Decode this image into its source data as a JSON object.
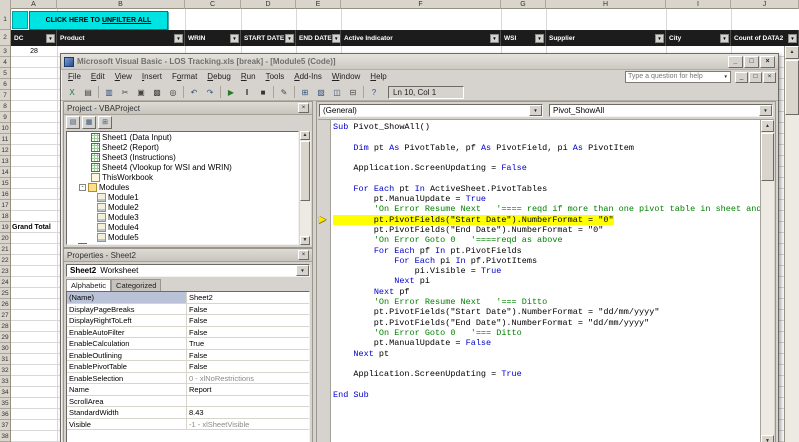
{
  "icons": {
    "dropdown": "▼",
    "scroll_up": "▲",
    "scroll_down": "▼",
    "close": "×",
    "minimize": "_",
    "restore": "□",
    "execution_arrow": "▶",
    "filter_arrow": "▼"
  },
  "excel": {
    "column_letters": [
      "A",
      "B",
      "C",
      "D",
      "E",
      "F",
      "G",
      "H",
      "I",
      "J"
    ],
    "filter_headers": [
      "DC",
      "Product",
      "WRIN",
      "START DATE",
      "END DATE",
      "Active Indicator",
      "WSI",
      "Supplier",
      "City",
      "Count of DATA2"
    ],
    "row_numbers": [
      "1",
      "2",
      "3",
      "4",
      "5",
      "6",
      "7",
      "8",
      "9",
      "10",
      "11",
      "12",
      "13",
      "14",
      "15",
      "16",
      "17",
      "18",
      "19",
      "20",
      "21",
      "22",
      "23",
      "24",
      "25",
      "26",
      "27",
      "28",
      "29",
      "30",
      "31",
      "32",
      "33",
      "34",
      "35",
      "36",
      "37",
      "38"
    ],
    "unfilter_button": {
      "prefix": "CLICK HERE TO ",
      "underline": "UNFILTER ALL"
    },
    "cells": {
      "a3": "28",
      "grand_total": "Grand Total"
    }
  },
  "vbe": {
    "title": "Microsoft Visual Basic - LOS Tracking.xls [break] - [Module5 (Code)]",
    "help_box": "Type a question for help",
    "position_indicator": "Ln 10, Col 1",
    "menus": [
      {
        "label": "File",
        "u": 0
      },
      {
        "label": "Edit",
        "u": 0
      },
      {
        "label": "View",
        "u": 0
      },
      {
        "label": "Insert",
        "u": 0
      },
      {
        "label": "Format",
        "u": 1
      },
      {
        "label": "Debug",
        "u": 0
      },
      {
        "label": "Run",
        "u": 0
      },
      {
        "label": "Tools",
        "u": 0
      },
      {
        "label": "Add-Ins",
        "u": 0
      },
      {
        "label": "Window",
        "u": 0
      },
      {
        "label": "Help",
        "u": 0
      }
    ],
    "toolbar": [
      {
        "name": "view-excel-icon",
        "glyph": "X",
        "color": "#1f7145"
      },
      {
        "name": "insert-userform-icon",
        "glyph": "▤",
        "color": "#444444"
      },
      {
        "name": "save-icon",
        "glyph": "▥",
        "color": "#33527a"
      },
      {
        "name": "cut-icon",
        "glyph": "✂",
        "color": "#444444"
      },
      {
        "name": "copy-icon",
        "glyph": "▣",
        "color": "#444444"
      },
      {
        "name": "paste-icon",
        "glyph": "▩",
        "color": "#444444"
      },
      {
        "name": "find-icon",
        "glyph": "◎",
        "color": "#333333"
      },
      {
        "name": "undo-icon",
        "glyph": "↶",
        "color": "#33527a"
      },
      {
        "name": "redo-icon",
        "glyph": "↷",
        "color": "#33527a"
      },
      {
        "name": "run-icon",
        "glyph": "▶",
        "color": "#2a7a2a"
      },
      {
        "name": "break-icon",
        "glyph": "‖",
        "color": "#333333"
      },
      {
        "name": "reset-icon",
        "glyph": "■",
        "color": "#333333"
      },
      {
        "name": "design-mode-icon",
        "glyph": "✎",
        "color": "#444444"
      },
      {
        "name": "project-explorer-icon",
        "glyph": "⊞",
        "color": "#33527a"
      },
      {
        "name": "properties-window-icon",
        "glyph": "▧",
        "color": "#33527a"
      },
      {
        "name": "object-browser-icon",
        "glyph": "◫",
        "color": "#33527a"
      },
      {
        "name": "toolbox-icon",
        "glyph": "⊟",
        "color": "#444444"
      },
      {
        "name": "help-icon",
        "glyph": "?",
        "color": "#33527a"
      }
    ],
    "project": {
      "title": "Project - VBAProject",
      "tools": [
        {
          "name": "view-code-icon",
          "glyph": "▤"
        },
        {
          "name": "view-object-icon",
          "glyph": "▦"
        },
        {
          "name": "toggle-folders-icon",
          "glyph": "⊞"
        }
      ],
      "items": [
        {
          "label": "Sheet1 (Data Input)",
          "icon": "sheet",
          "indent": 24,
          "exp": ""
        },
        {
          "label": "Sheet2 (Report)",
          "icon": "sheet",
          "indent": 24,
          "exp": ""
        },
        {
          "label": "Sheet3 (Instructions)",
          "icon": "sheet",
          "indent": 24,
          "exp": ""
        },
        {
          "label": "Sheet4 (Vlookup for WSI and WRIN)",
          "icon": "sheet",
          "indent": 24,
          "exp": ""
        },
        {
          "label": "ThisWorkbook",
          "icon": "workbook",
          "indent": 24,
          "exp": ""
        },
        {
          "label": "Modules",
          "icon": "folder",
          "indent": 12,
          "exp": "-"
        },
        {
          "label": "Module1",
          "icon": "module",
          "indent": 30,
          "exp": ""
        },
        {
          "label": "Module2",
          "icon": "module",
          "indent": 30,
          "exp": ""
        },
        {
          "label": "Module3",
          "icon": "module",
          "indent": 30,
          "exp": ""
        },
        {
          "label": "Module4",
          "icon": "module",
          "indent": 30,
          "exp": ""
        },
        {
          "label": "Module5",
          "icon": "module",
          "indent": 30,
          "exp": ""
        },
        {
          "label": "VBAProject (LOS Tracking.xls)",
          "icon": "project",
          "indent": 2,
          "exp": "+"
        }
      ]
    },
    "properties": {
      "title": "Properties - Sheet2",
      "object_name": "Sheet2",
      "object_type": "Worksheet",
      "tabs": [
        "Alphabetic",
        "Categorized"
      ],
      "rows": [
        [
          "(Name)",
          "Sheet2",
          ""
        ],
        [
          "DisplayPageBreaks",
          "False",
          ""
        ],
        [
          "DisplayRightToLeft",
          "False",
          ""
        ],
        [
          "EnableAutoFilter",
          "False",
          ""
        ],
        [
          "EnableCalculation",
          "True",
          ""
        ],
        [
          "EnableOutlining",
          "False",
          ""
        ],
        [
          "EnablePivotTable",
          "False",
          ""
        ],
        [
          "EnableSelection",
          "0 - xlNoRestrictions",
          "dim"
        ],
        [
          "Name",
          "Report",
          ""
        ],
        [
          "ScrollArea",
          "",
          ""
        ],
        [
          "StandardWidth",
          "8.43",
          ""
        ],
        [
          "Visible",
          "-1 - xlSheetVisible",
          "dim"
        ]
      ]
    },
    "code": {
      "object_dropdown": "(General)",
      "proc_dropdown": "Pivot_ShowAll",
      "current_line": 10,
      "lines": [
        {
          "segs": [
            [
              "k",
              "Sub"
            ],
            [
              "n",
              " Pivot_ShowAll()"
            ]
          ]
        },
        {
          "segs": []
        },
        {
          "segs": [
            [
              "n",
              "    "
            ],
            [
              "k",
              "Dim"
            ],
            [
              "n",
              " pt "
            ],
            [
              "k",
              "As"
            ],
            [
              "n",
              " PivotTable, pf "
            ],
            [
              "k",
              "As"
            ],
            [
              "n",
              " PivotField, pi "
            ],
            [
              "k",
              "As"
            ],
            [
              "n",
              " PivotItem"
            ]
          ]
        },
        {
          "segs": []
        },
        {
          "segs": [
            [
              "n",
              "    Application.ScreenUpdating = "
            ],
            [
              "k",
              "False"
            ]
          ]
        },
        {
          "segs": []
        },
        {
          "segs": [
            [
              "n",
              "    "
            ],
            [
              "k",
              "For"
            ],
            [
              "n",
              " "
            ],
            [
              "k",
              "Each"
            ],
            [
              "n",
              " pt "
            ],
            [
              "k",
              "In"
            ],
            [
              "n",
              " ActiveSheet.PivotTables"
            ]
          ]
        },
        {
          "segs": [
            [
              "n",
              "        pt.ManualUpdate = "
            ],
            [
              "k",
              "True"
            ]
          ]
        },
        {
          "segs": [
            [
              "n",
              "        "
            ],
            [
              "c",
              "'On Error Resume Next   '==== reqd if more than one pivot table in sheet and o"
            ]
          ]
        },
        {
          "hl": true,
          "segs": [
            [
              "n",
              "        pt.PivotFields(\"Start Date\").NumberFormat = \"0\""
            ]
          ]
        },
        {
          "segs": [
            [
              "n",
              "        pt.PivotFields(\"End Date\").NumberFormat = \"0\""
            ]
          ]
        },
        {
          "segs": [
            [
              "n",
              "        "
            ],
            [
              "c",
              "'On Error Goto 0   '====reqd as above"
            ]
          ]
        },
        {
          "segs": [
            [
              "n",
              "        "
            ],
            [
              "k",
              "For"
            ],
            [
              "n",
              " "
            ],
            [
              "k",
              "Each"
            ],
            [
              "n",
              " pf "
            ],
            [
              "k",
              "In"
            ],
            [
              "n",
              " pt.PivotFields"
            ]
          ]
        },
        {
          "segs": [
            [
              "n",
              "            "
            ],
            [
              "k",
              "For"
            ],
            [
              "n",
              " "
            ],
            [
              "k",
              "Each"
            ],
            [
              "n",
              " pi "
            ],
            [
              "k",
              "In"
            ],
            [
              "n",
              " pf.PivotItems"
            ]
          ]
        },
        {
          "segs": [
            [
              "n",
              "                pi.Visible = "
            ],
            [
              "k",
              "True"
            ]
          ]
        },
        {
          "segs": [
            [
              "n",
              "            "
            ],
            [
              "k",
              "Next"
            ],
            [
              "n",
              " pi"
            ]
          ]
        },
        {
          "segs": [
            [
              "n",
              "        "
            ],
            [
              "k",
              "Next"
            ],
            [
              "n",
              " pf"
            ]
          ]
        },
        {
          "segs": [
            [
              "n",
              "        "
            ],
            [
              "c",
              "'On Error Resume Next   '=== Ditto"
            ]
          ]
        },
        {
          "segs": [
            [
              "n",
              "        pt.PivotFields(\"Start Date\").NumberFormat = \"dd/mm/yyyy\""
            ]
          ]
        },
        {
          "segs": [
            [
              "n",
              "        pt.PivotFields(\"End Date\").NumberFormat = \"dd/mm/yyyy\""
            ]
          ]
        },
        {
          "segs": [
            [
              "n",
              "        "
            ],
            [
              "c",
              "'On Error Goto 0   '=== Ditto"
            ]
          ]
        },
        {
          "segs": [
            [
              "n",
              "        pt.ManualUpdate = "
            ],
            [
              "k",
              "False"
            ]
          ]
        },
        {
          "segs": [
            [
              "n",
              "    "
            ],
            [
              "k",
              "Next"
            ],
            [
              "n",
              " pt"
            ]
          ]
        },
        {
          "segs": []
        },
        {
          "segs": [
            [
              "n",
              "    Application.ScreenUpdating = "
            ],
            [
              "k",
              "True"
            ]
          ]
        },
        {
          "segs": []
        },
        {
          "segs": [
            [
              "k",
              "End Sub"
            ]
          ]
        }
      ]
    }
  }
}
